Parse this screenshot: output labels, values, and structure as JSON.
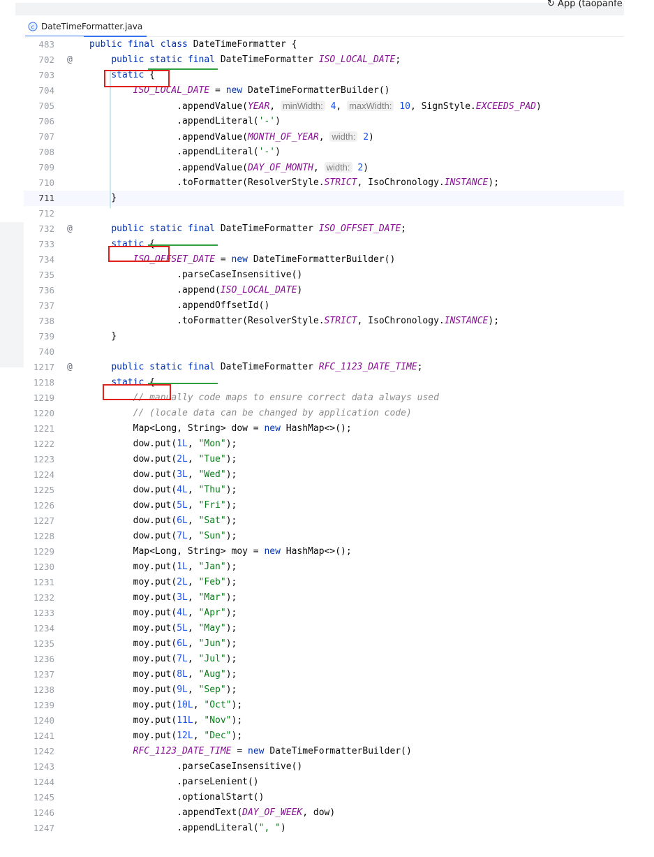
{
  "window": {
    "project_label": "App (taopanfe"
  },
  "tab": {
    "file_name": "DateTimeFormatter.java",
    "icon": "java-class-icon"
  },
  "colors": {
    "keyword": "#0033b3",
    "field": "#871094",
    "string": "#067d17",
    "number": "#1750eb",
    "comment": "#8c8c8c",
    "highlight_box": "#e0201b",
    "underline": "#2e9e3e"
  },
  "code_lines": [
    {
      "n": "483",
      "tokens": [
        [
          "kw",
          "public final class "
        ],
        [
          "",
          "DateTimeFormatter {"
        ]
      ]
    },
    {
      "n": "702",
      "mark": "@",
      "tokens": [
        [
          "",
          "    "
        ],
        [
          "kw",
          "public static final "
        ],
        [
          "",
          "DateTimeFormatter "
        ],
        [
          "fld",
          "ISO_LOCAL_DATE"
        ],
        [
          "",
          ";"
        ]
      ]
    },
    {
      "n": "703",
      "tokens": [
        [
          "",
          "    "
        ],
        [
          "kw",
          "static "
        ],
        [
          "",
          "{"
        ]
      ]
    },
    {
      "n": "704",
      "tokens": [
        [
          "",
          "        "
        ],
        [
          "fld",
          "ISO_LOCAL_DATE"
        ],
        [
          "",
          " = "
        ],
        [
          "kw",
          "new "
        ],
        [
          "",
          "DateTimeFormatterBuilder()"
        ]
      ]
    },
    {
      "n": "705",
      "tokens": [
        [
          "",
          "                .appendValue("
        ],
        [
          "fld",
          "YEAR"
        ],
        [
          "",
          ", "
        ],
        [
          "hint",
          "minWidth:"
        ],
        [
          "",
          " "
        ],
        [
          "num",
          "4"
        ],
        [
          "",
          ", "
        ],
        [
          "hint",
          "maxWidth:"
        ],
        [
          "",
          " "
        ],
        [
          "num",
          "10"
        ],
        [
          "",
          ", SignStyle."
        ],
        [
          "fld",
          "EXCEEDS_PAD"
        ],
        [
          "",
          ")"
        ]
      ]
    },
    {
      "n": "706",
      "tokens": [
        [
          "",
          "                .appendLiteral("
        ],
        [
          "str",
          "'-'"
        ],
        [
          "",
          ")"
        ]
      ]
    },
    {
      "n": "707",
      "tokens": [
        [
          "",
          "                .appendValue("
        ],
        [
          "fld",
          "MONTH_OF_YEAR"
        ],
        [
          "",
          ", "
        ],
        [
          "hint",
          "width:"
        ],
        [
          "",
          " "
        ],
        [
          "num",
          "2"
        ],
        [
          "",
          ")"
        ]
      ]
    },
    {
      "n": "708",
      "tokens": [
        [
          "",
          "                .appendLiteral("
        ],
        [
          "str",
          "'-'"
        ],
        [
          "",
          ")"
        ]
      ]
    },
    {
      "n": "709",
      "tokens": [
        [
          "",
          "                .appendValue("
        ],
        [
          "fld",
          "DAY_OF_MONTH"
        ],
        [
          "",
          ", "
        ],
        [
          "hint",
          "width:"
        ],
        [
          "",
          " "
        ],
        [
          "num",
          "2"
        ],
        [
          "",
          ")"
        ]
      ]
    },
    {
      "n": "710",
      "tokens": [
        [
          "",
          "                .toFormatter(ResolverStyle."
        ],
        [
          "fld",
          "STRICT"
        ],
        [
          "",
          ", IsoChronology."
        ],
        [
          "fld",
          "INSTANCE"
        ],
        [
          "",
          ");"
        ]
      ]
    },
    {
      "n": "711",
      "caret": true,
      "tokens": [
        [
          "",
          "    }"
        ]
      ]
    },
    {
      "n": "712",
      "tokens": []
    },
    {
      "n": "732",
      "mark": "@",
      "tokens": [
        [
          "",
          "    "
        ],
        [
          "kw",
          "public static final "
        ],
        [
          "",
          "DateTimeFormatter "
        ],
        [
          "fld",
          "ISO_OFFSET_DATE"
        ],
        [
          "",
          ";"
        ]
      ]
    },
    {
      "n": "733",
      "tokens": [
        [
          "",
          "    "
        ],
        [
          "kw",
          "static "
        ],
        [
          "",
          "{"
        ]
      ]
    },
    {
      "n": "734",
      "tokens": [
        [
          "",
          "        "
        ],
        [
          "fld",
          "ISO_OFFSET_DATE"
        ],
        [
          "",
          " = "
        ],
        [
          "kw",
          "new "
        ],
        [
          "",
          "DateTimeFormatterBuilder()"
        ]
      ]
    },
    {
      "n": "735",
      "tokens": [
        [
          "",
          "                .parseCaseInsensitive()"
        ]
      ]
    },
    {
      "n": "736",
      "tokens": [
        [
          "",
          "                .append("
        ],
        [
          "fld",
          "ISO_LOCAL_DATE"
        ],
        [
          "",
          ")"
        ]
      ]
    },
    {
      "n": "737",
      "tokens": [
        [
          "",
          "                .appendOffsetId()"
        ]
      ]
    },
    {
      "n": "738",
      "tokens": [
        [
          "",
          "                .toFormatter(ResolverStyle."
        ],
        [
          "fld",
          "STRICT"
        ],
        [
          "",
          ", IsoChronology."
        ],
        [
          "fld",
          "INSTANCE"
        ],
        [
          "",
          ");"
        ]
      ]
    },
    {
      "n": "739",
      "tokens": [
        [
          "",
          "    }"
        ]
      ]
    },
    {
      "n": "740",
      "tokens": []
    },
    {
      "n": "1217",
      "mark": "@",
      "tokens": [
        [
          "",
          "    "
        ],
        [
          "kw",
          "public static final "
        ],
        [
          "",
          "DateTimeFormatter "
        ],
        [
          "fld",
          "RFC_1123_DATE_TIME"
        ],
        [
          "",
          ";"
        ]
      ]
    },
    {
      "n": "1218",
      "tokens": [
        [
          "",
          "    "
        ],
        [
          "kw",
          "static "
        ],
        [
          "",
          "{"
        ]
      ]
    },
    {
      "n": "1219",
      "tokens": [
        [
          "",
          "        "
        ],
        [
          "cmt",
          "// manually code maps to ensure correct data always used"
        ]
      ]
    },
    {
      "n": "1220",
      "tokens": [
        [
          "",
          "        "
        ],
        [
          "cmt",
          "// (locale data can be changed by application code)"
        ]
      ]
    },
    {
      "n": "1221",
      "tokens": [
        [
          "",
          "        Map<Long, String> dow = "
        ],
        [
          "kw",
          "new "
        ],
        [
          "",
          "HashMap<>();"
        ]
      ]
    },
    {
      "n": "1222",
      "tokens": [
        [
          "",
          "        dow.put("
        ],
        [
          "num",
          "1L"
        ],
        [
          "",
          ", "
        ],
        [
          "str",
          "\"Mon\""
        ],
        [
          "",
          ");"
        ]
      ]
    },
    {
      "n": "1223",
      "tokens": [
        [
          "",
          "        dow.put("
        ],
        [
          "num",
          "2L"
        ],
        [
          "",
          ", "
        ],
        [
          "str",
          "\"Tue\""
        ],
        [
          "",
          ");"
        ]
      ]
    },
    {
      "n": "1224",
      "tokens": [
        [
          "",
          "        dow.put("
        ],
        [
          "num",
          "3L"
        ],
        [
          "",
          ", "
        ],
        [
          "str",
          "\"Wed\""
        ],
        [
          "",
          ");"
        ]
      ]
    },
    {
      "n": "1225",
      "tokens": [
        [
          "",
          "        dow.put("
        ],
        [
          "num",
          "4L"
        ],
        [
          "",
          ", "
        ],
        [
          "str",
          "\"Thu\""
        ],
        [
          "",
          ");"
        ]
      ]
    },
    {
      "n": "1226",
      "tokens": [
        [
          "",
          "        dow.put("
        ],
        [
          "num",
          "5L"
        ],
        [
          "",
          ", "
        ],
        [
          "str",
          "\"Fri\""
        ],
        [
          "",
          ");"
        ]
      ]
    },
    {
      "n": "1227",
      "tokens": [
        [
          "",
          "        dow.put("
        ],
        [
          "num",
          "6L"
        ],
        [
          "",
          ", "
        ],
        [
          "str",
          "\"Sat\""
        ],
        [
          "",
          ");"
        ]
      ]
    },
    {
      "n": "1228",
      "tokens": [
        [
          "",
          "        dow.put("
        ],
        [
          "num",
          "7L"
        ],
        [
          "",
          ", "
        ],
        [
          "str",
          "\"Sun\""
        ],
        [
          "",
          ");"
        ]
      ]
    },
    {
      "n": "1229",
      "tokens": [
        [
          "",
          "        Map<Long, String> moy = "
        ],
        [
          "kw",
          "new "
        ],
        [
          "",
          "HashMap<>();"
        ]
      ]
    },
    {
      "n": "1230",
      "tokens": [
        [
          "",
          "        moy.put("
        ],
        [
          "num",
          "1L"
        ],
        [
          "",
          ", "
        ],
        [
          "str",
          "\"Jan\""
        ],
        [
          "",
          ");"
        ]
      ]
    },
    {
      "n": "1231",
      "tokens": [
        [
          "",
          "        moy.put("
        ],
        [
          "num",
          "2L"
        ],
        [
          "",
          ", "
        ],
        [
          "str",
          "\"Feb\""
        ],
        [
          "",
          ");"
        ]
      ]
    },
    {
      "n": "1232",
      "tokens": [
        [
          "",
          "        moy.put("
        ],
        [
          "num",
          "3L"
        ],
        [
          "",
          ", "
        ],
        [
          "str",
          "\"Mar\""
        ],
        [
          "",
          ");"
        ]
      ]
    },
    {
      "n": "1233",
      "tokens": [
        [
          "",
          "        moy.put("
        ],
        [
          "num",
          "4L"
        ],
        [
          "",
          ", "
        ],
        [
          "str",
          "\"Apr\""
        ],
        [
          "",
          ");"
        ]
      ]
    },
    {
      "n": "1234",
      "tokens": [
        [
          "",
          "        moy.put("
        ],
        [
          "num",
          "5L"
        ],
        [
          "",
          ", "
        ],
        [
          "str",
          "\"May\""
        ],
        [
          "",
          ");"
        ]
      ]
    },
    {
      "n": "1235",
      "tokens": [
        [
          "",
          "        moy.put("
        ],
        [
          "num",
          "6L"
        ],
        [
          "",
          ", "
        ],
        [
          "str",
          "\"Jun\""
        ],
        [
          "",
          ");"
        ]
      ]
    },
    {
      "n": "1236",
      "tokens": [
        [
          "",
          "        moy.put("
        ],
        [
          "num",
          "7L"
        ],
        [
          "",
          ", "
        ],
        [
          "str",
          "\"Jul\""
        ],
        [
          "",
          ");"
        ]
      ]
    },
    {
      "n": "1237",
      "tokens": [
        [
          "",
          "        moy.put("
        ],
        [
          "num",
          "8L"
        ],
        [
          "",
          ", "
        ],
        [
          "str",
          "\"Aug\""
        ],
        [
          "",
          ");"
        ]
      ]
    },
    {
      "n": "1238",
      "tokens": [
        [
          "",
          "        moy.put("
        ],
        [
          "num",
          "9L"
        ],
        [
          "",
          ", "
        ],
        [
          "str",
          "\"Sep\""
        ],
        [
          "",
          ");"
        ]
      ]
    },
    {
      "n": "1239",
      "tokens": [
        [
          "",
          "        moy.put("
        ],
        [
          "num",
          "10L"
        ],
        [
          "",
          ", "
        ],
        [
          "str",
          "\"Oct\""
        ],
        [
          "",
          ");"
        ]
      ]
    },
    {
      "n": "1240",
      "tokens": [
        [
          "",
          "        moy.put("
        ],
        [
          "num",
          "11L"
        ],
        [
          "",
          ", "
        ],
        [
          "str",
          "\"Nov\""
        ],
        [
          "",
          ");"
        ]
      ]
    },
    {
      "n": "1241",
      "tokens": [
        [
          "",
          "        moy.put("
        ],
        [
          "num",
          "12L"
        ],
        [
          "",
          ", "
        ],
        [
          "str",
          "\"Dec\""
        ],
        [
          "",
          ");"
        ]
      ]
    },
    {
      "n": "1242",
      "tokens": [
        [
          "",
          "        "
        ],
        [
          "fld",
          "RFC_1123_DATE_TIME"
        ],
        [
          "",
          " = "
        ],
        [
          "kw",
          "new "
        ],
        [
          "",
          "DateTimeFormatterBuilder()"
        ]
      ]
    },
    {
      "n": "1243",
      "tokens": [
        [
          "",
          "                .parseCaseInsensitive()"
        ]
      ]
    },
    {
      "n": "1244",
      "tokens": [
        [
          "",
          "                .parseLenient()"
        ]
      ]
    },
    {
      "n": "1245",
      "tokens": [
        [
          "",
          "                .optionalStart()"
        ]
      ]
    },
    {
      "n": "1246",
      "tokens": [
        [
          "",
          "                .appendText("
        ],
        [
          "fld",
          "DAY_OF_WEEK"
        ],
        [
          "",
          ", dow)"
        ]
      ]
    },
    {
      "n": "1247",
      "tokens": [
        [
          "",
          "                .appendLiteral("
        ],
        [
          "str",
          "\", \""
        ],
        [
          "",
          ")"
        ]
      ]
    }
  ]
}
